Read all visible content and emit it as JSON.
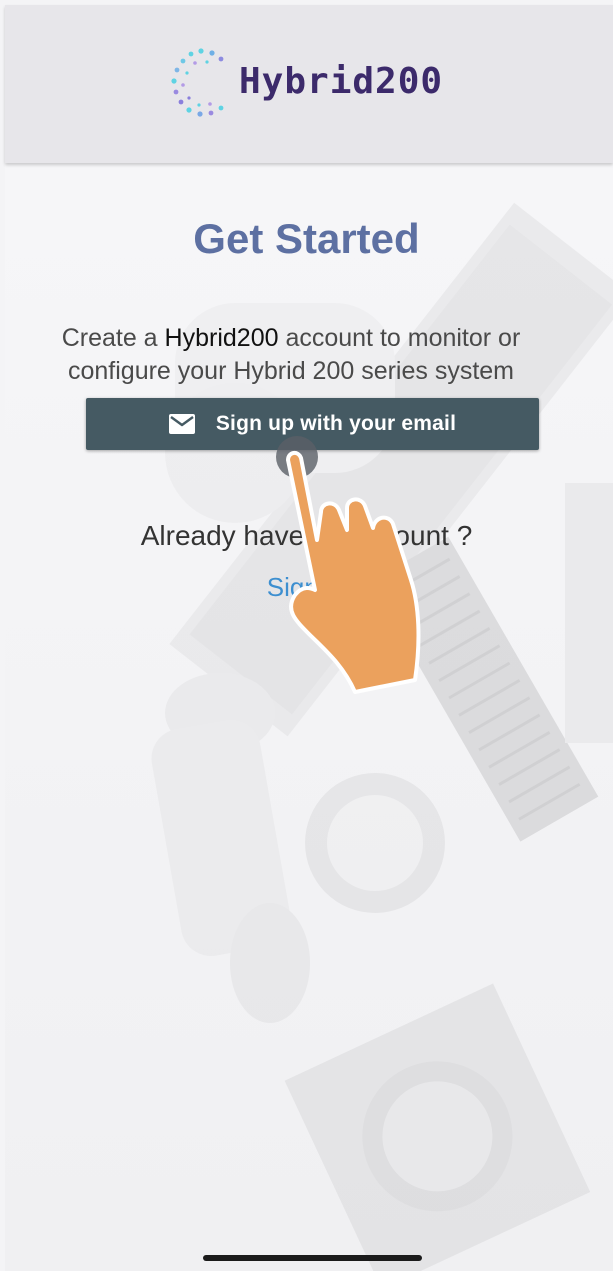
{
  "header": {
    "brand_name": "Hybrid200",
    "logo_icon": "dotted-circle-logo-icon"
  },
  "main": {
    "title": "Get Started",
    "description_prefix": "Create a ",
    "description_brand": "Hybrid200",
    "description_suffix": " account to monitor or configure your Hybrid 200 series system",
    "signup_button_label": "Sign up with your email",
    "signup_icon": "mail-icon",
    "already_text": "Already have an account ?",
    "signin_link": "Sign in"
  },
  "overlay": {
    "pointer": "hand-pointer-icon",
    "hand_color": "#eba15d"
  },
  "colors": {
    "title": "#5d70a2",
    "button_bg": "#455a63",
    "link": "#3d8fd0",
    "header_bg": "#e7e6ea"
  }
}
